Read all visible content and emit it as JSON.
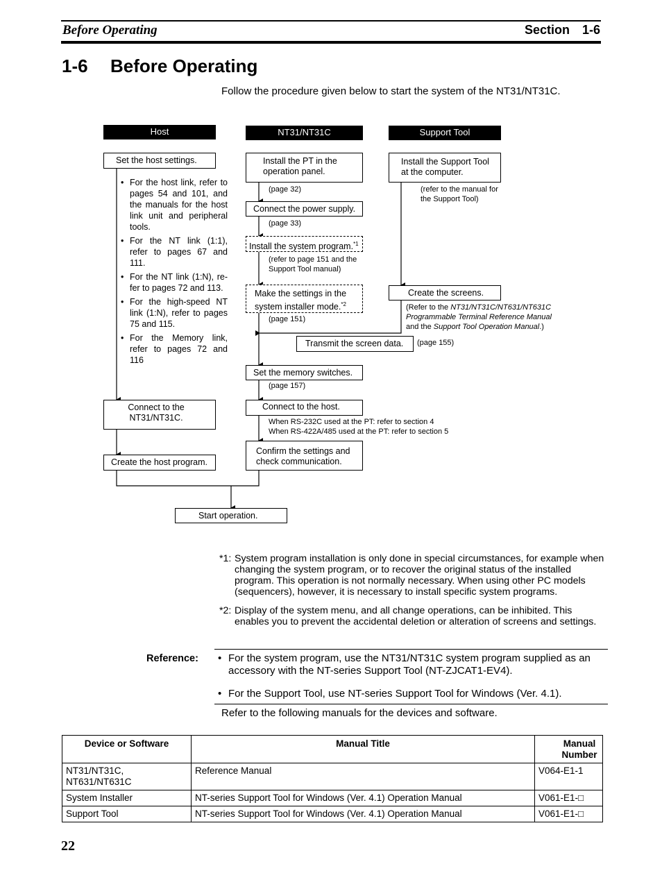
{
  "header": {
    "running_title": "Before Operating",
    "section_label": "Section",
    "section_number": "1-6"
  },
  "title": {
    "number": "1-6",
    "text": "Before Operating"
  },
  "intro": "Follow the procedure given below to start the system of the NT31/NT31C.",
  "flowchart": {
    "columns": {
      "host": "Host",
      "pt": "NT31/NT31C",
      "tool": "Support Tool"
    },
    "host": {
      "set_settings": "Set the host settings.",
      "bullets": [
        "For the host link, refer to pages 54 and 101, and the manuals for the host link unit and peripheral tools.",
        "For the NT link (1:1), refer to pages 67 and 111.",
        "For the NT link (1:N), re-fer to pages 72 and 113.",
        "For the high-speed NT link (1:N), refer to pages 75 and 115.",
        "For the Memory link, refer to pages 72 and 116"
      ],
      "connect": "Connect to the NT31/NT31C.",
      "create_program": "Create the host program."
    },
    "pt": {
      "install_pt": "Install the PT in the operation panel.",
      "note_install_pt": "(page 32)",
      "connect_power": "Connect the power supply.",
      "note_power": "(page 33)",
      "install_system": "Install the system program.",
      "install_system_sup": "*1",
      "note_system": "(refer to page 151 and the Support Tool manual)",
      "system_installer": "Make the settings in the system installer mode.",
      "system_installer_sup": "*2",
      "note_installer": "(page 151)",
      "memory_switches": "Set the memory switches.",
      "note_memory": "(page 157)",
      "connect_host": "Connect to the host.",
      "note_connect_1": "When RS-232C used at the PT: refer to section 4",
      "note_connect_2": "When RS-422A/485 used at the PT: refer to section 5",
      "confirm": "Confirm the settings and check communication."
    },
    "tool": {
      "install_tool": "Install the Support Tool at the computer.",
      "note_install_tool": "(refer to the manual for the Support Tool)",
      "create_screens": "Create the screens.",
      "note_screens_a": "(Refer to the ",
      "note_screens_b": "NT31/NT31C/NT631/NT631C Programmable Terminal Reference Manual",
      "note_screens_c": " and the ",
      "note_screens_d": "Support Tool Operation Manual",
      "note_screens_e": ".)",
      "transmit": "Transmit the screen data.",
      "note_transmit": "(page 155)"
    },
    "start": "Start operation."
  },
  "footnotes": [
    {
      "key": "*1:",
      "text": "System program installation is only done in special circumstances, for example when changing the system program, or to recover the original status of the installed program. This operation is not normally necessary. When using other PC models (sequencers), however, it is necessary to install specific system programs."
    },
    {
      "key": "*2:",
      "text": "Display of the system menu, and all change operations, can be inhibited. This enables you to prevent the accidental deletion or alteration of screens and settings."
    }
  ],
  "reference": {
    "label": "Reference:",
    "bullets": [
      "For the system program, use the NT31/NT31C system program supplied as an accessory with the NT-series Support Tool (NT-ZJCAT1-EV4).",
      "For the Support Tool, use NT-series Support Tool for Windows (Ver. 4.1)."
    ],
    "refer_text": "Refer to the following manuals for the devices and software."
  },
  "table": {
    "headers": [
      "Device or Software",
      "Manual Title",
      "Manual Number"
    ],
    "rows": [
      [
        "NT31/NT31C, NT631/NT631C",
        "Reference Manual",
        "V064-E1-1"
      ],
      [
        "System Installer",
        "NT-series Support Tool for Windows (Ver. 4.1) Operation Manual",
        "V061-E1-□"
      ],
      [
        "Support Tool",
        "NT-series Support Tool for Windows (Ver. 4.1) Operation Manual",
        "V061-E1-□"
      ]
    ]
  },
  "page_number": "22"
}
